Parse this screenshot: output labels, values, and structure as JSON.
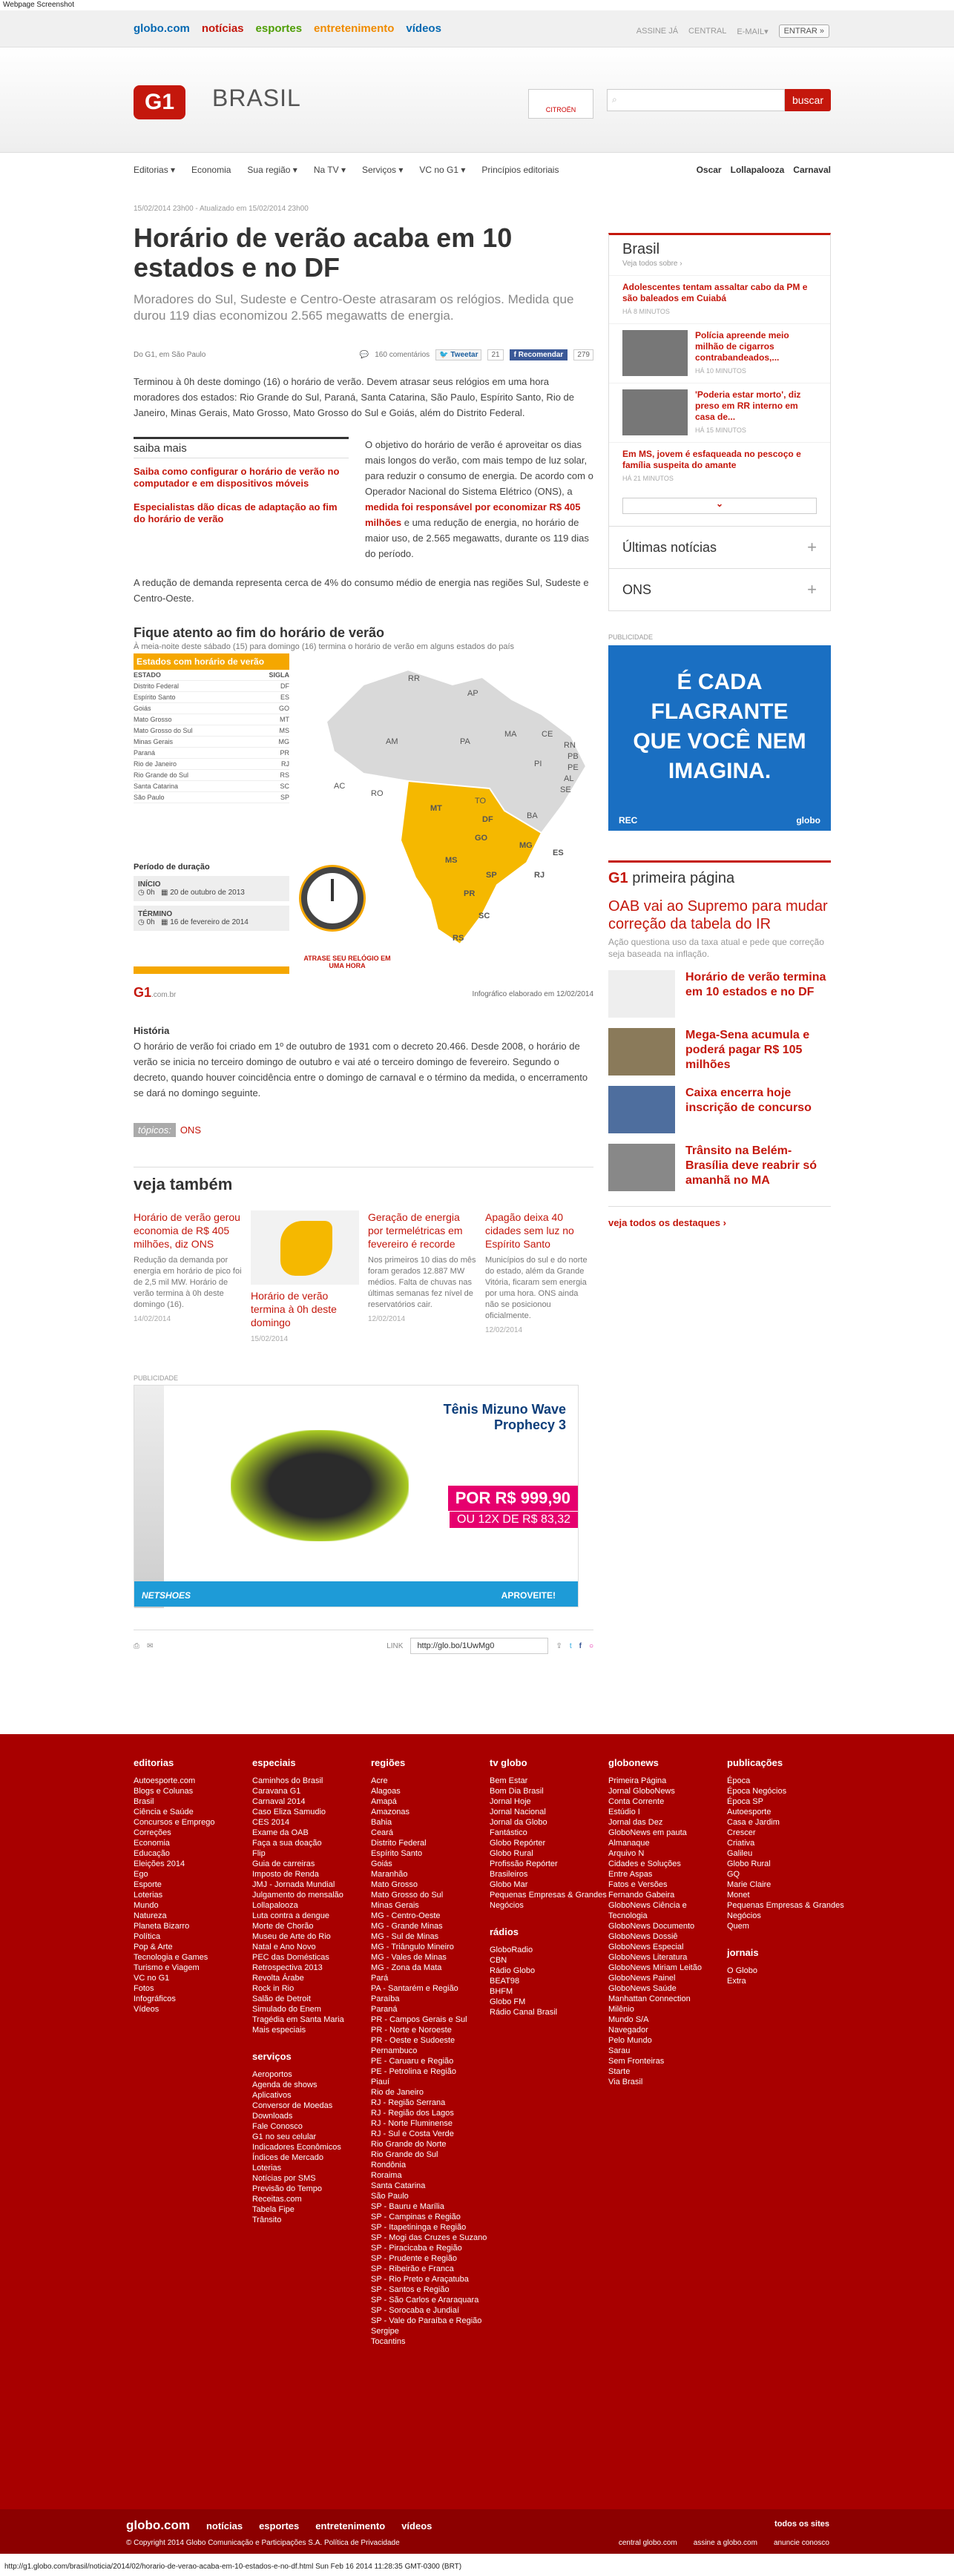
{
  "window_title": "Webpage Screenshot",
  "globobar": {
    "links": [
      {
        "label": "globo.com",
        "color": "#0669b2"
      },
      {
        "label": "notícias",
        "color": "#c4170c"
      },
      {
        "label": "esportes",
        "color": "#4f9e06"
      },
      {
        "label": "entretenimento",
        "color": "#f08b00"
      },
      {
        "label": "vídeos",
        "color": "#0669b2"
      }
    ],
    "assine": "ASSINE JÁ",
    "central": "CENTRAL",
    "email": "E-MAIL▾",
    "entrar": "ENTRAR »"
  },
  "header": {
    "logo": "G1",
    "section": "BRASIL",
    "brand_ad": "CITROËN",
    "search_placeholder": "",
    "search_button": "buscar"
  },
  "nav": {
    "items": [
      "Editorias ▾",
      "Economia",
      "Sua região ▾",
      "Na TV ▾",
      "Serviços ▾",
      "VC no G1 ▾",
      "Princípios editoriais"
    ],
    "right": [
      "Oscar",
      "Lollapalooza",
      "Carnaval"
    ]
  },
  "article": {
    "meta": "15/02/2014 23h00 - Atualizado em 15/02/2014 23h00",
    "title": "Horário de verão acaba em 10 estados e no DF",
    "subtitle": "Moradores do Sul, Sudeste e Centro-Oeste atrasaram os relógios. Medida que durou 119 dias economizou 2.565 megawatts de energia.",
    "byline": "Do G1, em São Paulo",
    "comments": "160 comentários",
    "tweet": "Tweetar",
    "tweet_count": "21",
    "fb": "Recomendar",
    "fb_count": "279",
    "p1": "Terminou à 0h deste domingo (16) o horário de verão. Devem atrasar seus relógios em uma hora moradores dos estados: Rio Grande do Sul, Paraná, Santa Catarina, São Paulo, Espírito Santo, Rio de Janeiro, Minas Gerais, Mato Grosso, Mato Grosso do Sul e Goiás, além do Distrito Federal.",
    "saiba_title": "saiba mais",
    "saiba_links": [
      "Saiba como configurar o horário de verão no computador e em dispositivos móveis",
      "Especialistas dão dicas de adaptação ao fim do horário de verão"
    ],
    "p2a": "O objetivo do horário de verão é aproveitar os dias mais longos do verão, com mais tempo de luz solar, para reduzir o consumo de energia. De acordo com o Operador Nacional do Sistema Elétrico (ONS), a ",
    "p2link": "medida foi responsável por economizar R$ 405 milhões",
    "p2b": " e uma redução de energia, no horário de maior uso, de 2.565 megawatts, durante os 119 dias do período.",
    "p3": "A redução de demanda representa cerca de 4% do consumo médio de energia nas regiões Sul, Sudeste e Centro-Oeste.",
    "infographic": {
      "title": "Fique atento ao fim do horário de verão",
      "subtitle": "À meia-noite deste sábado (15) para domingo (16) termina o horário de verão em alguns estados do país",
      "table_title": "Estados com horário de verão",
      "col1": "ESTADO",
      "col2": "SIGLA",
      "rows": [
        [
          "Distrito Federal",
          "DF"
        ],
        [
          "Espírito Santo",
          "ES"
        ],
        [
          "Goiás",
          "GO"
        ],
        [
          "Mato Grosso",
          "MT"
        ],
        [
          "Mato Grosso do Sul",
          "MS"
        ],
        [
          "Minas Gerais",
          "MG"
        ],
        [
          "Paraná",
          "PR"
        ],
        [
          "Rio de Janeiro",
          "RJ"
        ],
        [
          "Rio Grande do Sul",
          "RS"
        ],
        [
          "Santa Catarina",
          "SC"
        ],
        [
          "São Paulo",
          "SP"
        ]
      ],
      "period": "Período de duração",
      "start_label": "INÍCIO",
      "start_time": "0h",
      "start_date": "20 de outubro de 2013",
      "end_label": "TÉRMINO",
      "end_time": "0h",
      "end_date": "16 de fevereiro de 2014",
      "clock_note": "ATRASE SEU RELÓGIO EM UMA HORA",
      "logo": "G1",
      "logo_suffix": ".com.br",
      "credit": "Infográfico elaborado em 12/02/2014",
      "map_labels_gray": [
        "RR",
        "AP",
        "AM",
        "PA",
        "MA",
        "CE",
        "RN",
        "PB",
        "PE",
        "AL",
        "SE",
        "PI",
        "AC",
        "RO",
        "TO",
        "BA"
      ],
      "map_labels_yellow": [
        "MT",
        "GO",
        "DF",
        "MG",
        "ES",
        "MS",
        "SP",
        "RJ",
        "PR",
        "SC",
        "RS"
      ]
    },
    "hist_title": "História",
    "hist": "O horário de verão foi criado em 1º de outubro de 1931 com o decreto 20.466. Desde 2008, o horário de verão se inicia no terceiro domingo de outubro e vai até o terceiro domingo de fevereiro. Segundo o decreto, quando houver coincidência entre o domingo de carnaval e o término da medida, o encerramento se dará no domingo seguinte.",
    "tags_label": "tópicos:",
    "tags": "ONS",
    "veja_title": "veja também",
    "veja": [
      {
        "title": "Horário de verão gerou economia de R$ 405 milhões, diz ONS",
        "desc": "Redução da demanda por energia em horário de pico foi de 2,5 mil MW. Horário de verão termina à 0h deste domingo (16).",
        "date": "14/02/2014"
      },
      {
        "title": "Horário de verão termina à 0h deste domingo",
        "desc": "",
        "date": "15/02/2014"
      },
      {
        "title": "Geração de energia por termelétricas em fevereiro é recorde",
        "desc": "Nos primeiros 10 dias do mês foram gerados 12.887 MW médios. Falta de chuvas nas últimas semanas fez nível de reservatórios cair.",
        "date": "12/02/2014"
      },
      {
        "title": "Apagão deixa 40 cidades sem luz no Espírito Santo",
        "desc": "Municípios do sul e do norte do estado, além da Grande Vitória, ficaram sem energia por uma hora. ONS ainda não se posicionou oficialmente.",
        "date": "12/02/2014"
      }
    ],
    "ad_label": "PUBLICIDADE",
    "ad": {
      "title": "Tênis Mizuno Wave Prophecy 3",
      "price": "POR R$ 999,90",
      "installments": "OU 12X DE R$ 83,32",
      "brand": "NETSHOES",
      "cta": "APROVEITE!"
    },
    "share_label": "LINK",
    "short_url": "http://glo.bo/1UwMg0"
  },
  "sidebar": {
    "title": "Brasil",
    "all": "Veja todos sobre ›",
    "items": [
      {
        "title": "Adolescentes tentam assaltar cabo da PM e são baleados em Cuiabá",
        "ago": "HÁ 8 MINUTOS",
        "img": false
      },
      {
        "title": "Polícia apreende meio milhão de cigarros contrabandeados,...",
        "ago": "HÁ 10 MINUTOS",
        "img": true
      },
      {
        "title": "'Poderia estar morto', diz preso em RR interno em casa de...",
        "ago": "HÁ 15 MINUTOS",
        "img": true
      },
      {
        "title": "Em MS, jovem é esfaqueada no pescoço e família suspeita do amante",
        "ago": "HÁ 21 MINUTOS",
        "img": false
      }
    ],
    "acc1": "Últimas notícias",
    "acc2": "ONS",
    "ad_label": "PUBLICIDADE",
    "ad_text": "É CADA FLAGRANTE QUE VOCÊ NEM IMAGINA.",
    "ad_brand": "REC",
    "ad_brand2": "globo",
    "pp_logo": "G1",
    "pp_title": "primeira página",
    "pp_lead": "OAB vai ao Supremo para mudar correção da tabela do IR",
    "pp_leadsub": "Ação questiona uso da taxa atual e pede que correção seja baseada na inflação.",
    "pp_items": [
      "Horário de verão termina em 10 estados e no DF",
      "Mega-Sena acumula e poderá pagar R$ 105 milhões",
      "Caixa encerra hoje inscrição de concurso",
      "Trânsito na Belém-Brasília deve reabrir só amanhã no MA"
    ],
    "pp_more": "veja todos os destaques ›"
  },
  "footer": {
    "columns": [
      {
        "title": "editorias",
        "items": [
          "Autoesporte.com",
          "Blogs e Colunas",
          "Brasil",
          "Ciência e Saúde",
          "Concursos e Emprego",
          "Correções",
          "Economia",
          "Educação",
          "Eleições 2014",
          "Ego",
          "Esporte",
          "Loterias",
          "Mundo",
          "Natureza",
          "Planeta Bizarro",
          "Política",
          "Pop & Arte",
          "Tecnologia e Games",
          "Turismo e Viagem",
          "VC no G1",
          "Fotos",
          "Infográficos",
          "Vídeos"
        ]
      },
      {
        "title": "especiais",
        "items": [
          "Caminhos do Brasil",
          "Caravana G1",
          "Carnaval 2014",
          "Caso Eliza Samudio",
          "CES 2014",
          "Exame da OAB",
          "Faça a sua doação",
          "Flip",
          "Guia de carreiras",
          "Imposto de Renda",
          "JMJ - Jornada Mundial",
          "Julgamento do mensalão",
          "Lollapalooza",
          "Luta contra a dengue",
          "Morte de Chorão",
          "Museu de Arte do Rio",
          "Natal e Ano Novo",
          "PEC das Domésticas",
          "Retrospectiva 2013",
          "Revolta Árabe",
          "Rock in Rio",
          "Salão de Detroit",
          "Simulado do Enem",
          "Tragédia em Santa Maria",
          "Mais especiais"
        ],
        "title2": "serviços",
        "items2": [
          "Aeroportos",
          "Agenda de shows",
          "Aplicativos",
          "Conversor de Moedas",
          "Downloads",
          "Fale Conosco",
          "G1 no seu celular",
          "Indicadores Econômicos",
          "Índices de Mercado",
          "Loterias",
          "Notícias por SMS",
          "Previsão do Tempo",
          "Receitas.com",
          "Tabela Fipe",
          "Trânsito"
        ]
      },
      {
        "title": "regiões",
        "items": [
          "Acre",
          "Alagoas",
          "Amapá",
          "Amazonas",
          "Bahia",
          "Ceará",
          "Distrito Federal",
          "Espírito Santo",
          "Goiás",
          "Maranhão",
          "Mato Grosso",
          "Mato Grosso do Sul",
          "Minas Gerais",
          "MG - Centro-Oeste",
          "MG - Grande Minas",
          "MG - Sul de Minas",
          "MG - Triângulo Mineiro",
          "MG - Vales de Minas",
          "MG - Zona da Mata",
          "Pará",
          "PA - Santarém e Região",
          "Paraíba",
          "Paraná",
          "PR - Campos Gerais e Sul",
          "PR - Norte e Noroeste",
          "PR - Oeste e Sudoeste",
          "Pernambuco",
          "PE - Caruaru e Região",
          "PE - Petrolina e Região",
          "Piauí",
          "Rio de Janeiro",
          "RJ - Região Serrana",
          "RJ - Região dos Lagos",
          "RJ - Norte Fluminense",
          "RJ - Sul e Costa Verde",
          "Rio Grande do Norte",
          "Rio Grande do Sul",
          "Rondônia",
          "Roraima",
          "Santa Catarina",
          "São Paulo",
          "SP - Bauru e Marília",
          "SP - Campinas e Região",
          "SP - Itapetininga e Região",
          "SP - Mogi das Cruzes e Suzano",
          "SP - Piracicaba e Região",
          "SP - Prudente e Região",
          "SP - Ribeirão e Franca",
          "SP - Rio Preto e Araçatuba",
          "SP - Santos e Região",
          "SP - São Carlos e Araraquara",
          "SP - Sorocaba e Jundiaí",
          "SP - Vale do Paraíba e Região",
          "Sergipe",
          "Tocantins"
        ]
      },
      {
        "title": "tv globo",
        "items": [
          "Bem Estar",
          "Bom Dia Brasil",
          "Jornal Hoje",
          "Jornal Nacional",
          "Jornal da Globo",
          "Fantástico",
          "Globo Repórter",
          "Globo Rural",
          "Profissão Repórter",
          "Brasileiros",
          "Globo Mar",
          "Pequenas Empresas & Grandes Negócios"
        ],
        "title2": "rádios",
        "items2": [
          "GloboRadio",
          "CBN",
          "Rádio Globo",
          "BEAT98",
          "BHFM",
          "Globo FM",
          "Rádio Canal Brasil"
        ]
      },
      {
        "title": "globonews",
        "items": [
          "Primeira Página",
          "Jornal GloboNews",
          "Conta Corrente",
          "Estúdio I",
          "Jornal das Dez",
          "GloboNews em pauta",
          "Almanaque",
          "Arquivo N",
          "Cidades e Soluções",
          "Entre Aspas",
          "Fatos e Versões",
          "Fernando Gabeira",
          "GloboNews Ciência e Tecnologia",
          "GloboNews Documento",
          "GloboNews Dossiê",
          "GloboNews Especial",
          "GloboNews Literatura",
          "GloboNews Miriam Leitão",
          "GloboNews Painel",
          "GloboNews Saúde",
          "Manhattan Connection",
          "Milênio",
          "Mundo S/A",
          "Navegador",
          "Pelo Mundo",
          "Sarau",
          "Sem Fronteiras",
          "Starte",
          "Via Brasil"
        ]
      },
      {
        "title": "publicações",
        "items": [
          "Época",
          "Época Negócios",
          "Época SP",
          "Autoesporte",
          "Casa e Jardim",
          "Crescer",
          "Criativa",
          "Galileu",
          "Globo Rural",
          "GQ",
          "Marie Claire",
          "Monet",
          "Pequenas Empresas & Grandes Negócios",
          "Quem"
        ],
        "title2": "jornais",
        "items2": [
          "O Globo",
          "Extra"
        ]
      }
    ],
    "bar_links": [
      "globo.com",
      "notícias",
      "esportes",
      "entretenimento",
      "vídeos"
    ],
    "copyright": "© Copyright 2014 Globo Comunicação e Participações S.A. Política de Privacidade",
    "todos": "todos os sites",
    "right_links": [
      "central globo.com",
      "assine a globo.com",
      "anuncie conosco"
    ]
  },
  "status_bar": "http://g1.globo.com/brasil/noticia/2014/02/horario-de-verao-acaba-em-10-estados-e-no-df.html Sun Feb 16 2014 11:28:35 GMT-0300 (BRT)"
}
